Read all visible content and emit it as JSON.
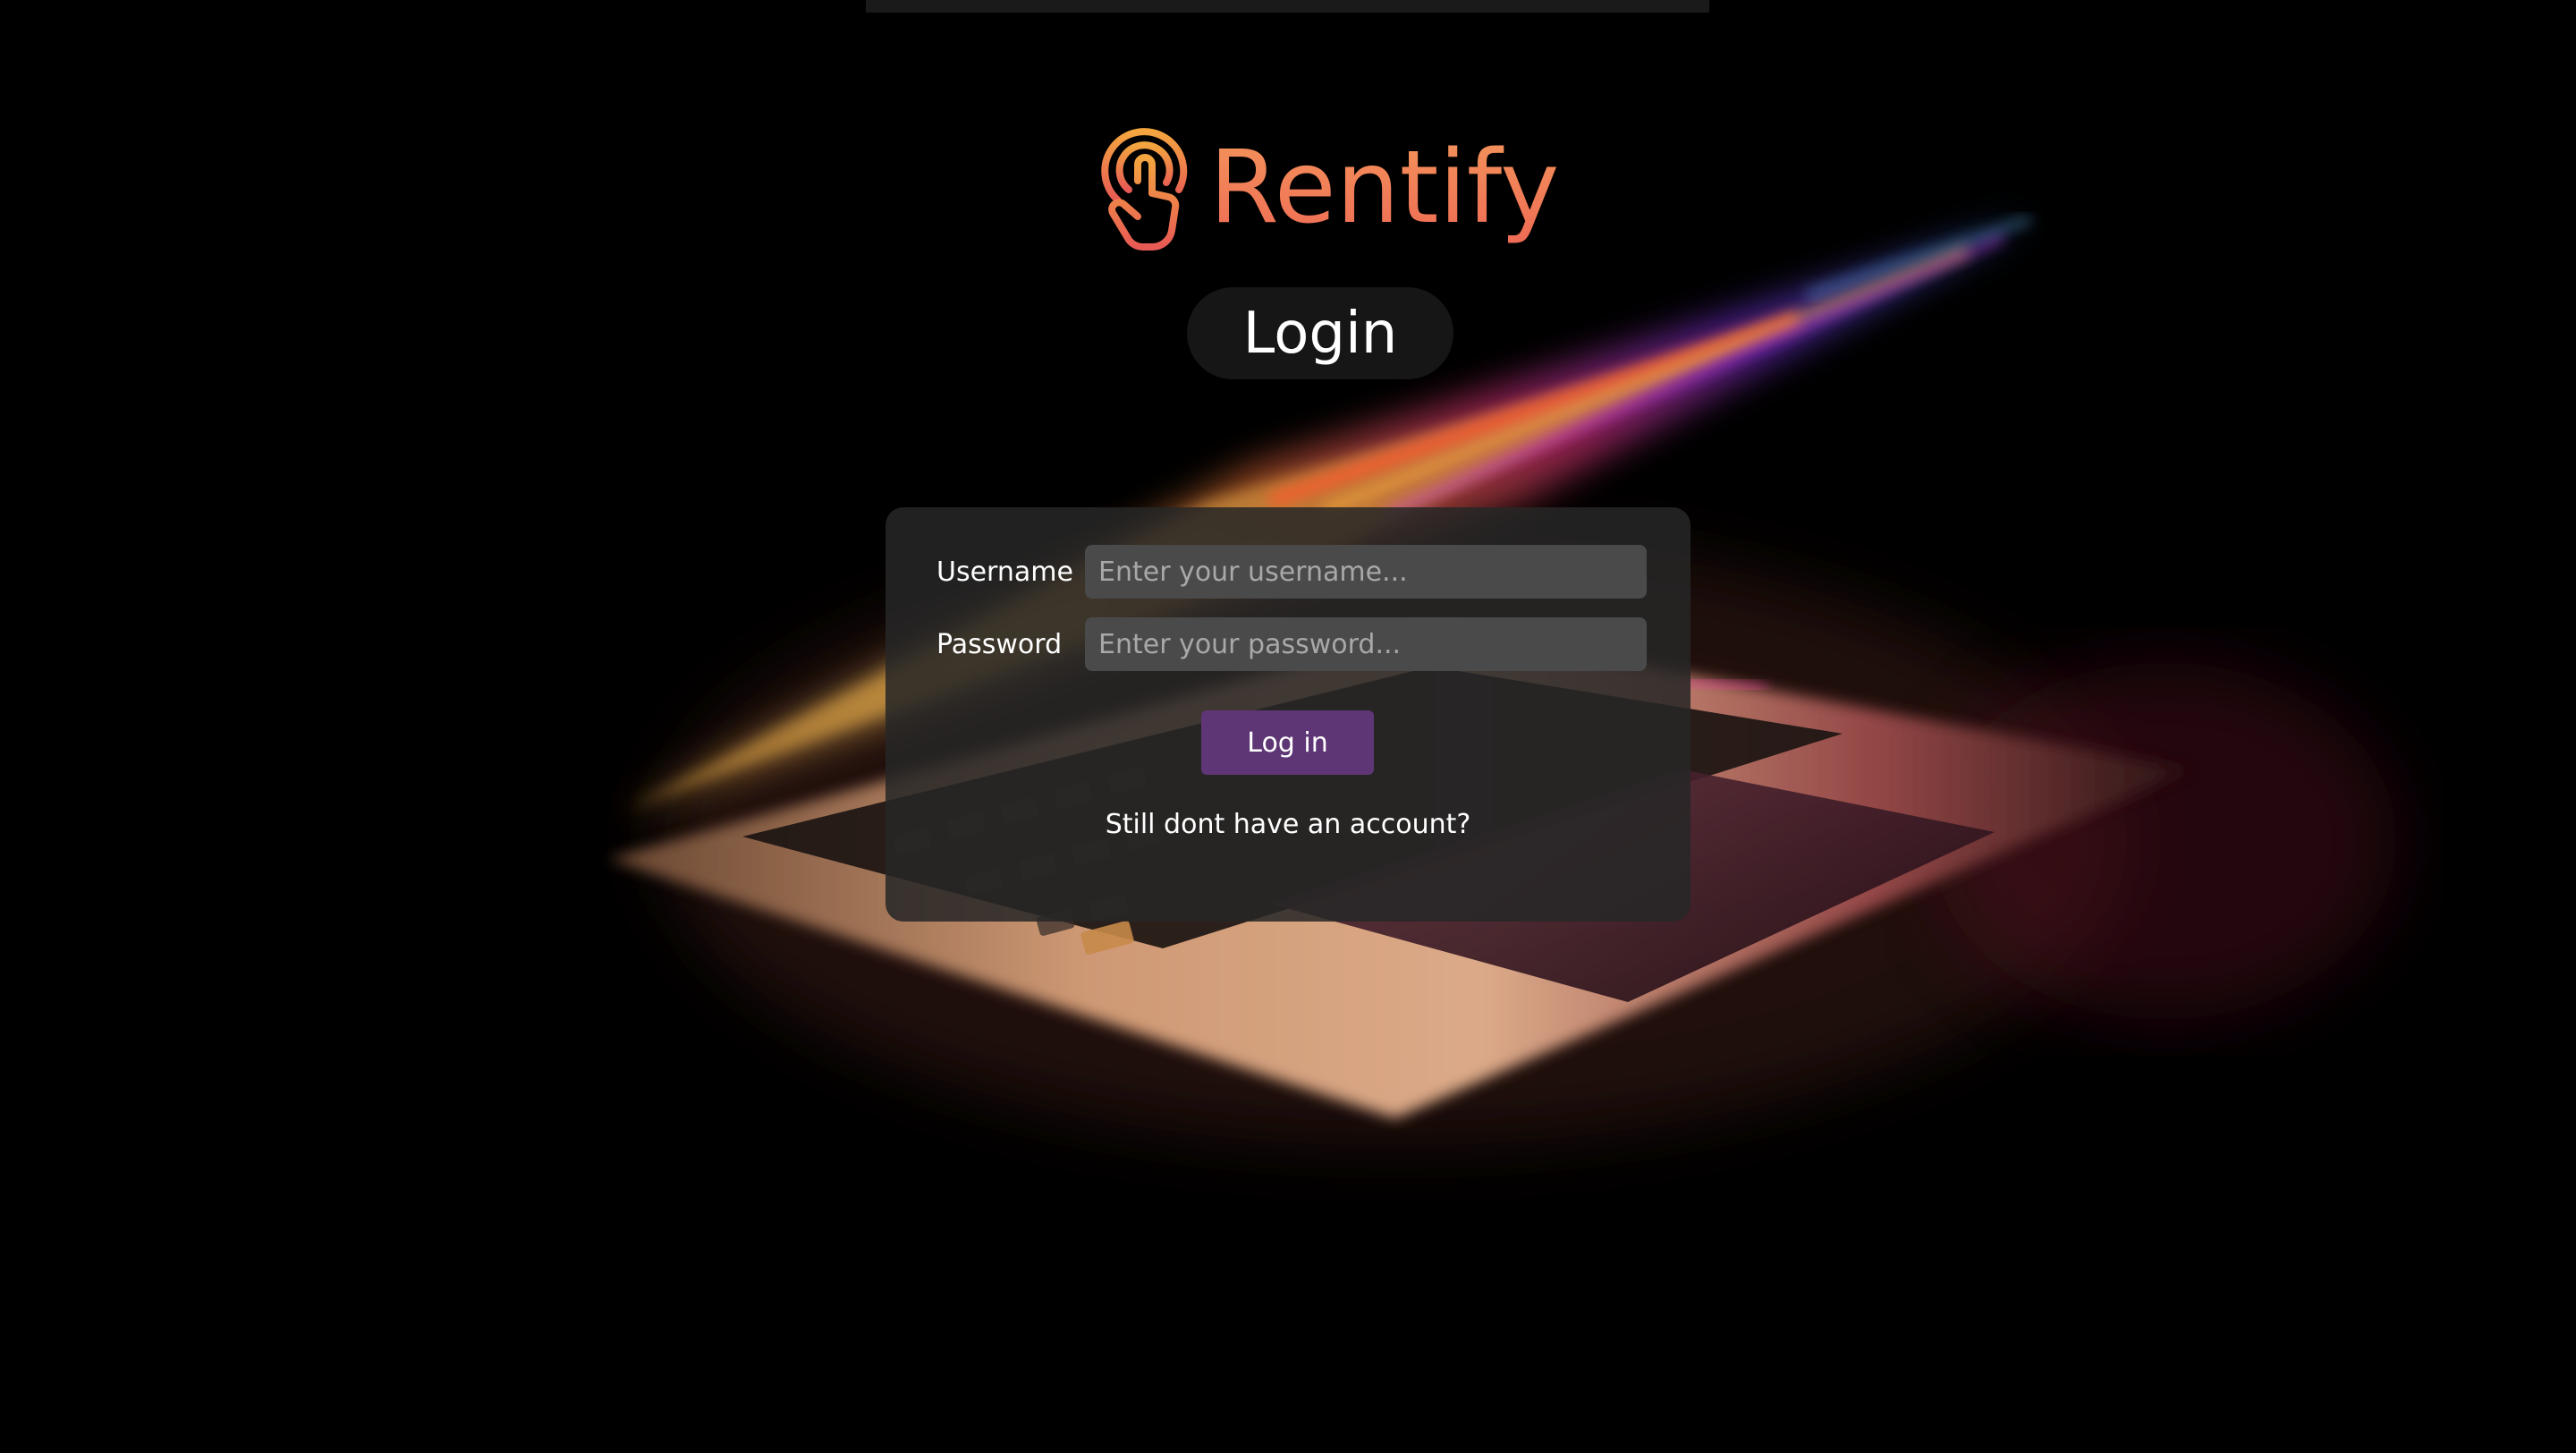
{
  "brand": {
    "name": "Rentify",
    "icon": "tap-hand-icon",
    "color_start": "#f3a53f",
    "color_end": "#e85a55"
  },
  "page": {
    "heading": "Login"
  },
  "form": {
    "username_label": "Username",
    "username_placeholder": "Enter your username...",
    "password_label": "Password",
    "password_placeholder": "Enter your password...",
    "submit_label": "Log in",
    "signup_link": "Still dont have an account?"
  },
  "colors": {
    "background": "#000000",
    "card": "#262626",
    "input": "#4a4a4a",
    "button": "#5e3675",
    "pill": "#161616"
  },
  "background_image": "laptop-photo"
}
